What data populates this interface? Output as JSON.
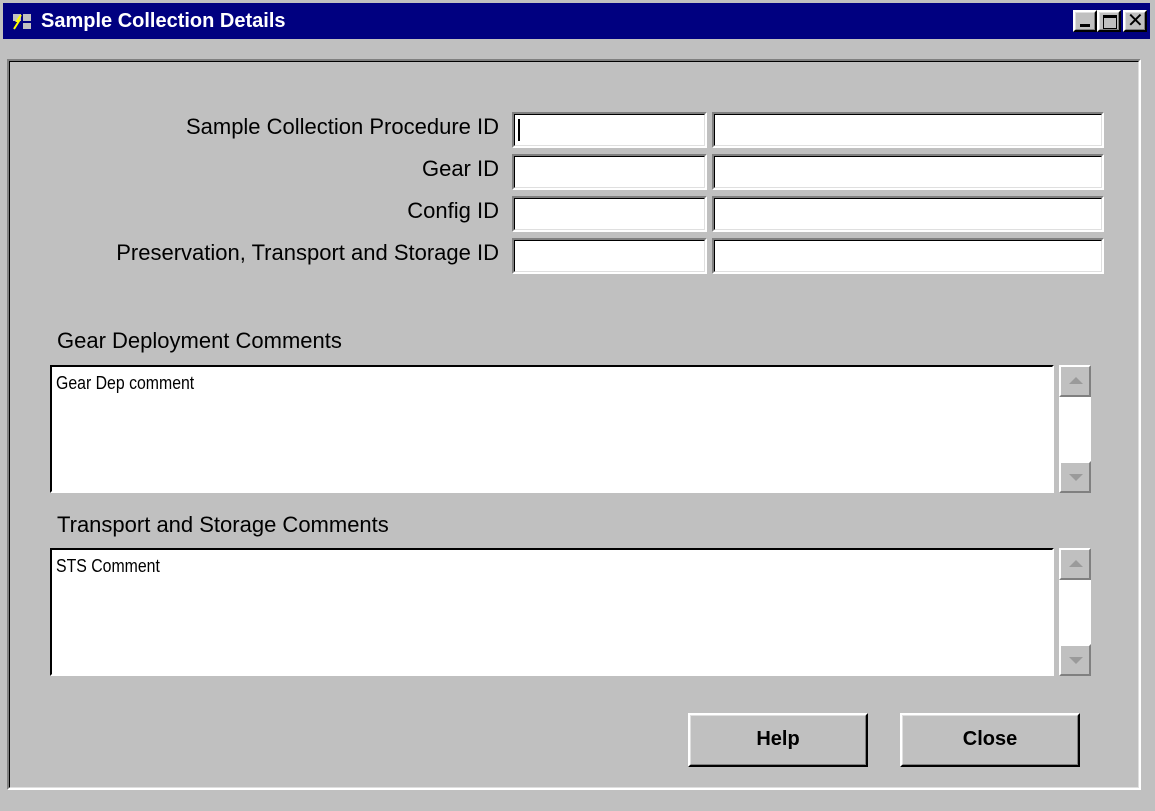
{
  "window": {
    "title": "Sample Collection Details",
    "icon": "app-icon",
    "controls": {
      "minimize": "minimize-icon",
      "maximize": "maximize-icon",
      "close": "close-icon"
    }
  },
  "fields": [
    {
      "label": "Sample Collection Procedure ID",
      "code": "",
      "description": ""
    },
    {
      "label": "Gear ID",
      "code": "",
      "description": ""
    },
    {
      "label": "Config ID",
      "code": "",
      "description": ""
    },
    {
      "label": "Preservation, Transport and Storage  ID",
      "code": "",
      "description": ""
    }
  ],
  "gear_deployment": {
    "label": "Gear Deployment Comments",
    "text": "Gear Dep comment"
  },
  "transport_storage": {
    "label": "Transport and Storage Comments",
    "text": "STS Comment"
  },
  "buttons": {
    "help": "Help",
    "close": "Close"
  }
}
